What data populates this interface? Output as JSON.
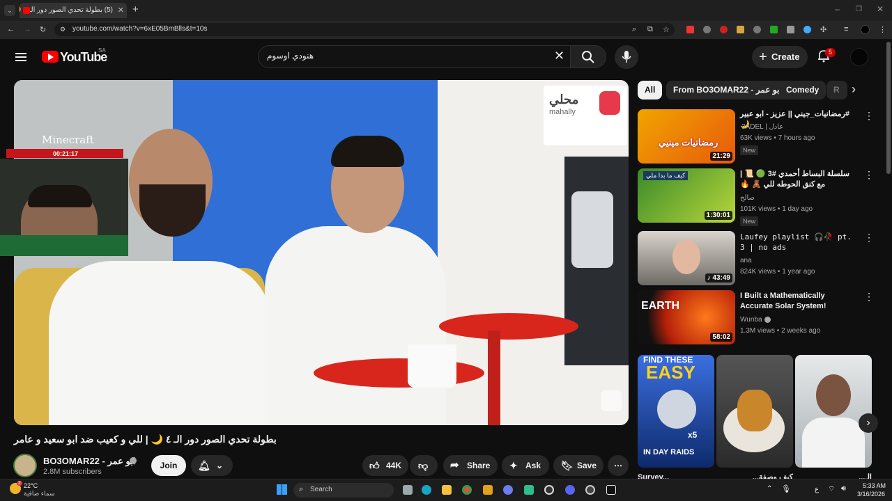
{
  "browser": {
    "tab_title": "(5) بطولة تحدي الصور دور الـ ٤ 🌙",
    "tab_close": "✕",
    "new_tab": "+",
    "url": "youtube.com/watch?v=6xE05BmBlls&t=10s"
  },
  "youtube": {
    "logo_text": "YouTube",
    "region": "SA",
    "search_value": "هنودي اوسوم",
    "create_label": "Create",
    "notif_count": "5"
  },
  "video": {
    "overlay_game": "Minecraft",
    "overlay_time": "00:21:17",
    "logo_text": "محلي",
    "logo_sub": "mahally",
    "title": "بطولة تحدي الصور دور الـ ٤ 🌙 | للي و كعيب ضد ابو سعيد و عامر",
    "channel": "BO3OMAR22 - ابو عمر",
    "subscribers": "2.8M subscribers",
    "join_label": "Join",
    "likes": "44K",
    "share_label": "Share",
    "ask_label": "Ask",
    "save_label": "Save"
  },
  "chips": [
    "All",
    "From BO3OMAR22 - ابو عمر",
    "Comedy",
    "R"
  ],
  "recommendations": [
    {
      "title": "#رمضانيات_جيني || عزيز - ابو عبير 🌙",
      "channel": "3ADEL | عادل",
      "meta": "63K views • 7 hours ago",
      "badge": "New",
      "duration": "21:29",
      "thumb_text": "رمضانيات مينيي"
    },
    {
      "title": "سلسلة البساط أحمدي #3 🟢 📜 | مع كنق الحوطه للي 🧸 🔥",
      "channel": "صالح",
      "meta": "101K views • 1 day ago",
      "badge": "New",
      "duration": "1:30:01",
      "thumb_text": "كيف ما بدا ملي"
    },
    {
      "title": "Laufey playlist 🎧🥀 pt. 3 | no ads",
      "channel": "ana",
      "meta": "824K views • 1 year ago",
      "badge": "",
      "duration": "43:49",
      "thumb_text": ""
    },
    {
      "title": "I Built a Mathematically Accurate Solar System!",
      "channel": "Wunba",
      "meta": "1.3M views • 2 weeks ago",
      "badge": "",
      "duration": "58:02",
      "thumb_text": "EARTH"
    }
  ],
  "shorts": [
    {
      "top_text": "FIND THESE",
      "big_text": "EASY",
      "count": "x5",
      "bottom_text": "IN DAY RAIDS",
      "caption": "Survey..."
    },
    {
      "caption": "كيف وصفة..."
    },
    {
      "caption": "الـ..."
    }
  ],
  "taskbar": {
    "temp": "22°C",
    "weather": "سماء صافية",
    "weather_badge": "2",
    "search_label": "Search",
    "time": "5:33 AM",
    "date": "3/16/2026",
    "lang": "ع"
  }
}
